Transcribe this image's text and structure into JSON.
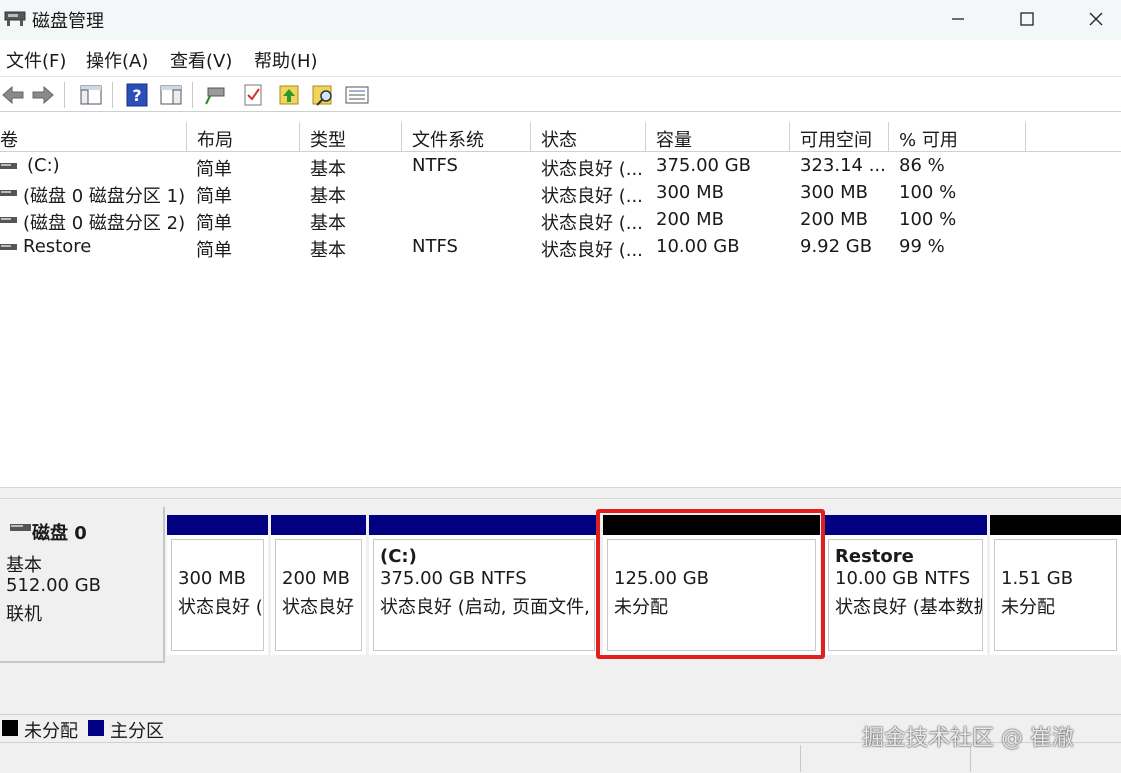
{
  "window": {
    "title": "磁盘管理",
    "app_icon": "disk-management-icon"
  },
  "menu": [
    "文件(F)",
    "操作(A)",
    "查看(V)",
    "帮助(H)"
  ],
  "toolbar": {
    "icons": [
      "back-icon",
      "forward-icon",
      "console-tree-icon",
      "help-icon",
      "show-hide-icon",
      "connect-icon",
      "check-icon",
      "up-arrow-icon",
      "search-icon",
      "list-icon"
    ]
  },
  "volumes": {
    "columns": [
      "卷",
      "布局",
      "类型",
      "文件系统",
      "状态",
      "容量",
      "可用空间",
      "% 可用"
    ],
    "rows": [
      {
        "vol": "(C:)",
        "layout": "简单",
        "type": "基本",
        "fs": "NTFS",
        "status": "状态良好 (...",
        "capacity": "375.00 GB",
        "free": "323.14 ...",
        "pct": "86 %"
      },
      {
        "vol": "(磁盘 0 磁盘分区 1)",
        "layout": "简单",
        "type": "基本",
        "fs": "",
        "status": "状态良好 (...",
        "capacity": "300 MB",
        "free": "300 MB",
        "pct": "100 %"
      },
      {
        "vol": "(磁盘 0 磁盘分区 2)",
        "layout": "简单",
        "type": "基本",
        "fs": "",
        "status": "状态良好 (...",
        "capacity": "200 MB",
        "free": "200 MB",
        "pct": "100 %"
      },
      {
        "vol": "Restore",
        "layout": "简单",
        "type": "基本",
        "fs": "NTFS",
        "status": "状态良好 (...",
        "capacity": "10.00 GB",
        "free": "9.92 GB",
        "pct": "99 %"
      }
    ]
  },
  "disk": {
    "name": "磁盘 0",
    "type": "基本",
    "size": "512.00 GB",
    "state": "联机"
  },
  "partitions": [
    {
      "name": "",
      "line1": "300 MB",
      "line2": "状态良好 (",
      "kind": "primary"
    },
    {
      "name": "",
      "line1": "200 MB",
      "line2": "状态良好",
      "kind": "primary"
    },
    {
      "name": "(C:)",
      "line1": "375.00 GB NTFS",
      "line2": "状态良好 (启动, 页面文件, 故",
      "kind": "primary"
    },
    {
      "name": "",
      "line1": "125.00 GB",
      "line2": "未分配",
      "kind": "unallocated"
    },
    {
      "name": "Restore",
      "line1": "10.00 GB NTFS",
      "line2": "状态良好 (基本数据",
      "kind": "primary"
    },
    {
      "name": "",
      "line1": "1.51 GB",
      "line2": "未分配",
      "kind": "unallocated"
    }
  ],
  "legend": {
    "unallocated": "未分配",
    "primary": "主分区"
  },
  "colors": {
    "primary": "#000080",
    "unallocated": "#000000",
    "highlight": "#e02020"
  },
  "watermark": "掘金技术社区 @ 崔澈"
}
